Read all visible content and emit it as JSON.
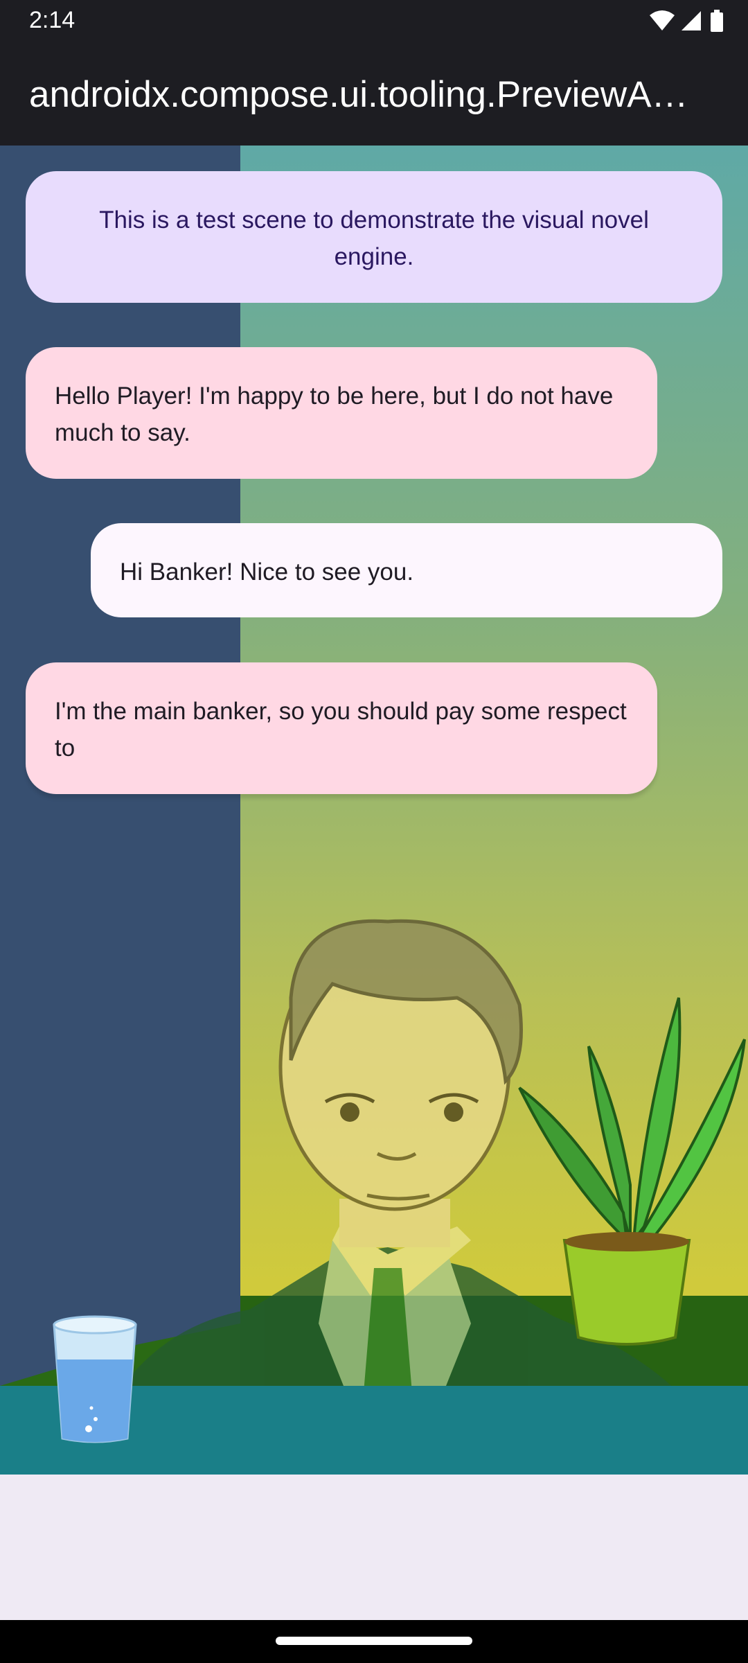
{
  "status_bar": {
    "time": "2:14",
    "icons": [
      "wifi-icon",
      "cellular-signal-icon",
      "battery-icon"
    ]
  },
  "app_bar": {
    "title": "androidx.compose.ui.tooling.PreviewA…"
  },
  "dialogue": {
    "narrator": "This is a test scene to demonstrate the visual novel engine.",
    "banker_1": "Hello Player! I'm happy to be here, but I do not have much to say.",
    "player_1": "Hi Banker! Nice to see you.",
    "banker_2": "I'm the main banker, so you should pay some respect to"
  },
  "colors": {
    "narrator_bubble": "#e8dcfd",
    "character_bubble": "#ffd8e4",
    "player_bubble": "#fdf6fe",
    "system_bar": "#1d1d22"
  }
}
